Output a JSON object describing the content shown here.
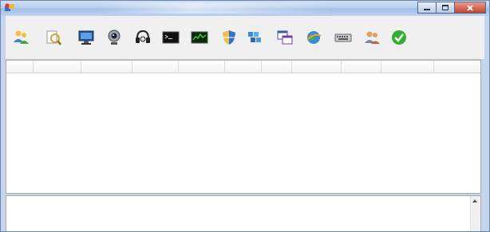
{
  "window": {
    "title": ""
  },
  "menu": [
    {
      "label": ""
    },
    {
      "label": ""
    }
  ],
  "toolbar": [
    {
      "label": "",
      "icon": "user-online-icon"
    },
    {
      "label": "",
      "icon": "file-manager-icon"
    },
    {
      "label": "",
      "icon": "screen-control-icon"
    },
    {
      "label": "",
      "icon": "webcam-icon"
    },
    {
      "label": "",
      "icon": "headset-icon"
    },
    {
      "label": "",
      "icon": "terminal-icon"
    },
    {
      "label": "",
      "icon": "process-icon"
    },
    {
      "label": "",
      "icon": "service-shield-icon"
    },
    {
      "label": "",
      "icon": "registry-icon"
    },
    {
      "label": "",
      "icon": "window-manager-icon"
    },
    {
      "label": "",
      "icon": "share-globe-icon"
    },
    {
      "label": "",
      "icon": "keyboard-icon"
    },
    {
      "label": "",
      "icon": "create-client-icon"
    },
    {
      "label": "",
      "icon": "minimize-check-icon"
    }
  ],
  "table": {
    "columns": [
      "",
      "",
      "",
      "",
      "",
      "",
      "",
      "",
      "",
      "",
      ""
    ],
    "rows": []
  },
  "log": {
    "lines": [
      ""
    ]
  },
  "colors": {
    "title_bar": "#b5cdec",
    "log_text": "#1f3ad1",
    "close_button": "#c5442e"
  }
}
